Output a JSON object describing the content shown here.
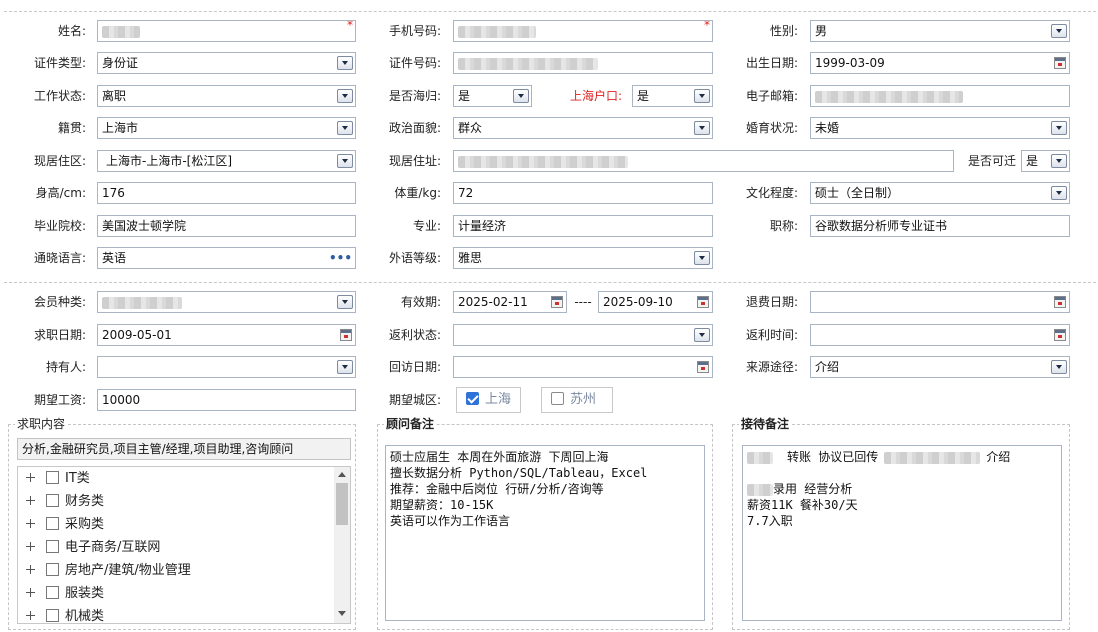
{
  "labels": {
    "name": "姓名:",
    "phone": "手机号码:",
    "gender": "性别:",
    "id_type": "证件类型:",
    "id_number": "证件号码:",
    "birth_date": "出生日期:",
    "work_status": "工作状态:",
    "returnee": "是否海归:",
    "shanghai_hukou": "上海户口:",
    "email": "电子邮箱:",
    "native_place": "籍贯:",
    "political_status": "政治面貌:",
    "marital_status": "婚育状况:",
    "current_area": "现居住区:",
    "current_address": "现居住址:",
    "relocatable": "是否可迁",
    "height": "身高/cm:",
    "weight": "体重/kg:",
    "education": "文化程度:",
    "school": "毕业院校:",
    "major": "专业:",
    "title": "职称:",
    "language": "通晓语言:",
    "language_level": "外语等级:",
    "member_type": "会员种类:",
    "validity": "有效期:",
    "refund_date": "退费日期:",
    "job_date": "求职日期:",
    "rebate_status": "返利状态:",
    "rebate_time": "返利时间:",
    "holder": "持有人:",
    "visit_date": "回访日期:",
    "source": "来源途径:",
    "expected_salary": "期望工资:",
    "expected_city": "期望城区:"
  },
  "values": {
    "gender": "男",
    "id_type": "身份证",
    "birth_date": "1999-03-09",
    "work_status": "离职",
    "returnee": "是",
    "shanghai_hukou": "是",
    "native_place": "上海市",
    "political_status": "群众",
    "marital_status": "未婚",
    "current_area": "上海市-上海市-[松江区]",
    "relocatable": "是",
    "height": "176",
    "weight": "72",
    "education": "硕士（全日制）",
    "school": "美国波士顿学院",
    "major": "计量经济",
    "title": "谷歌数据分析师专业证书",
    "language": "英语",
    "language_level": "雅思",
    "validity_start": "2025-02-11",
    "validity_sep": "----",
    "validity_end": "2025-09-10",
    "job_date": "2009-05-01",
    "source": "介绍",
    "expected_salary": "10000"
  },
  "required_mark": "*",
  "cities": [
    {
      "label": "上海",
      "checked": true
    },
    {
      "label": "苏州",
      "checked": false
    }
  ],
  "job_panel": {
    "title": "求职内容",
    "summary": "分析,金融研究员,项目主管/经理,项目助理,咨询顾问",
    "tree": [
      "IT类",
      "财务类",
      "采购类",
      "电子商务/互联网",
      "房地产/建筑/物业管理",
      "服装类",
      "机械类"
    ]
  },
  "advisor_panel": {
    "title": "顾问备注",
    "text": "硕士应届生 本周在外面旅游 下周回上海\n擅长数据分析 Python/SQL/Tableau，Excel\n推荐：金融中后岗位 行研/分析/咨询等\n期望薪资：10-15K\n英语可以作为工作语言"
  },
  "reception_panel": {
    "title": "接待备注",
    "line1_a": "转账  协议已回传",
    "line1_b": "介绍",
    "line2": "录用 经营分析",
    "line3": "薪资11K 餐补30/天",
    "line4": "7.7入职"
  },
  "icons": {
    "dropdown": "chevron-down-icon",
    "calendar": "calendar-icon",
    "more": "ellipsis-icon",
    "tree_expand": "plus-icon",
    "checkbox": "checkbox-icon"
  },
  "colors": {
    "required": "#e02020",
    "checkbox_on": "#2f72d8",
    "field_border": "#a9b4c4"
  }
}
